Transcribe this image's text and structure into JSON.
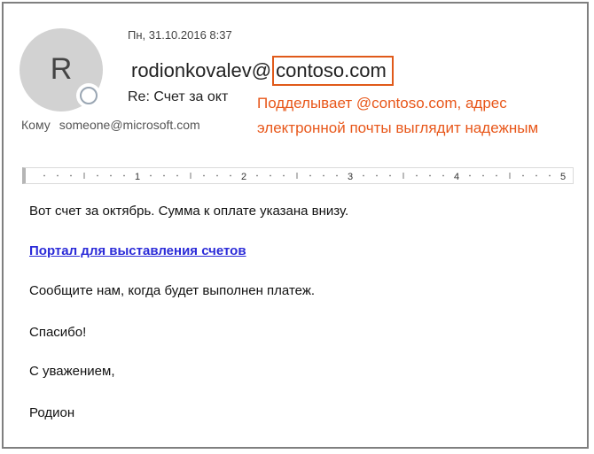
{
  "header": {
    "avatar_initial": "R",
    "date": "Пн, 31.10.2016 8:37",
    "sender_user": "rodionkovalev@",
    "sender_domain": "contoso.com",
    "subject": "Re: Счет за окт",
    "to_label": "Кому",
    "to_value": "someone@microsoft.com"
  },
  "annotation": {
    "line1": "Подделывает @contoso.com, адрес",
    "line2": "электронной почты выглядит надежным",
    "color": "#e8571a"
  },
  "ruler": {
    "labels": [
      "1",
      "2",
      "3",
      "4",
      "5"
    ]
  },
  "body": {
    "line1": "Вот счет за октябрь. Сумма к оплате указана внизу.",
    "link": "Портал для выставления счетов",
    "line2": "Сообщите нам, когда будет выполнен платеж.",
    "line3": "Спасибо!",
    "line4": "С уважением,",
    "signature": "Родион"
  }
}
